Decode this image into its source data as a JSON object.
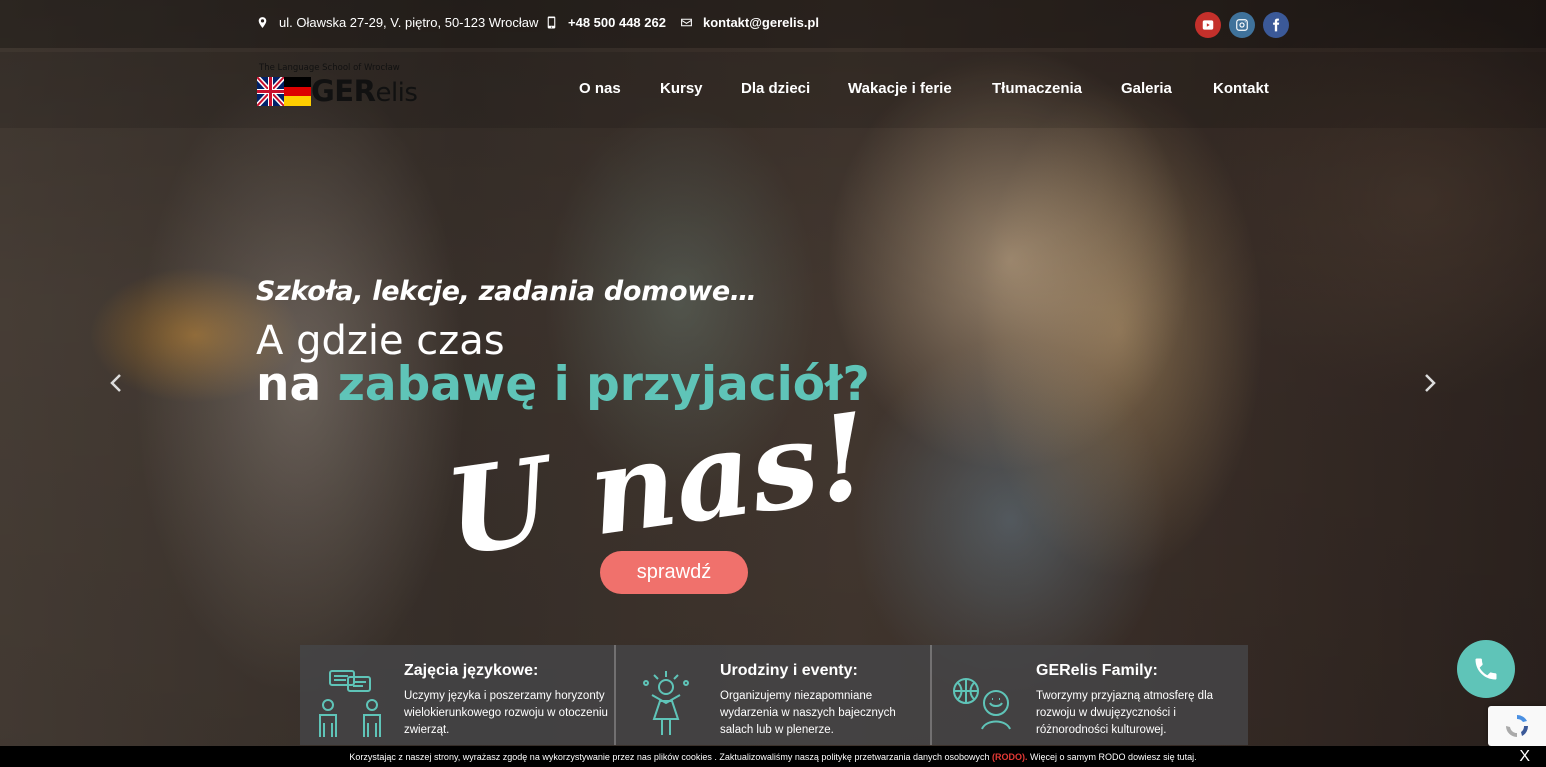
{
  "topbar": {
    "address": "ul. Oławska 27-29, V. piętro, 50-123 Wrocław",
    "phone": "+48 500 448 262",
    "email": "kontakt@gerelis.pl"
  },
  "social": {
    "icons": [
      "youtube-icon",
      "instagram-icon",
      "facebook-icon"
    ],
    "colors": {
      "youtube": "#c4302b",
      "instagram": "#3f729b",
      "facebook": "#3b5998"
    }
  },
  "logo": {
    "tagline": "The Language School of Wrocław",
    "word_strong": "GER",
    "word_light": "elis"
  },
  "nav": {
    "items": [
      "O nas",
      "Kursy",
      "Dla dzieci",
      "Wakacje i ferie",
      "Tłumaczenia",
      "Galeria",
      "Kontakt"
    ]
  },
  "hero": {
    "subtitle": "Szkoła, lekcje, zadania domowe…",
    "line1": "A gdzie czas",
    "line2_white": "na",
    "line2_accent": "zabawę i przyjaciół?",
    "script": "U nas!",
    "cta": "sprawdź",
    "accent_color": "#5fc4b8",
    "cta_color": "#f0716c"
  },
  "features": [
    {
      "title": "Zajęcia językowe:",
      "text": "Uczymy języka i poszerzamy horyzonty wielokierunkowego rozwoju w otoczeniu zwierząt.",
      "icon": "people-chat-icon"
    },
    {
      "title": "Urodziny i eventy:",
      "text": "Organizujemy niezapomniane wydarzenia w naszych bajecznych salach lub w plenerze.",
      "icon": "child-celebration-icon"
    },
    {
      "title": "GERelis Family:",
      "text": "Tworzymy przyjazną atmosferę dla rozwoju w dwujęzyczności i różnorodności kulturowej.",
      "icon": "family-ball-icon"
    }
  ],
  "cookie": {
    "text_before": "Korzystając z naszej strony, wyrażasz zgodę na wykorzystywanie przez nas plików cookies . Zaktualizowaliśmy naszą politykę przetwarzania danych osobowych",
    "rodo": "(RODO).",
    "text_after": "Więcej o samym RODO dowiesz się tutaj.",
    "close": "X"
  }
}
